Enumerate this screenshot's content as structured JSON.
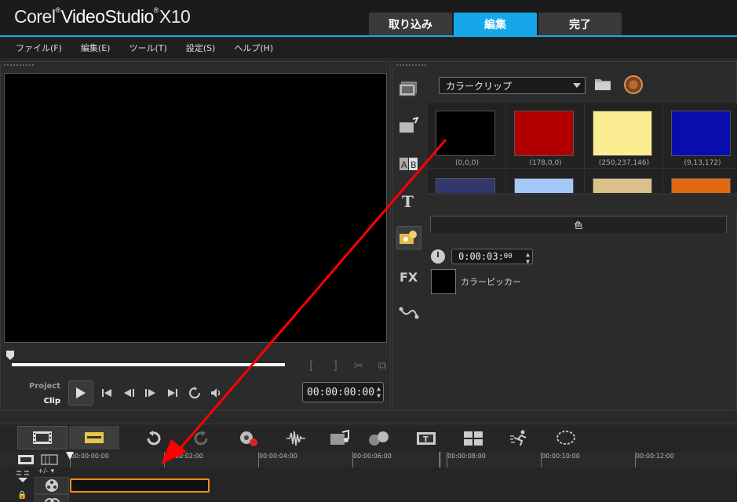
{
  "app": {
    "brand_prefix": "Corel",
    "brand_name": "VideoStudio",
    "brand_version": "X10"
  },
  "mode_tabs": [
    {
      "label": "取り込み",
      "active": false
    },
    {
      "label": "編集",
      "active": true
    },
    {
      "label": "完了",
      "active": false
    }
  ],
  "menu": [
    "ファイル(F)",
    "編集(E)",
    "ツール(T)",
    "設定(S)",
    "ヘルプ(H)"
  ],
  "player": {
    "project_label": "Project",
    "clip_label": "Clip",
    "timecode": "00:00:00:00",
    "timecode_hours": "00:00:00",
    "timecode_frames": "00"
  },
  "library": {
    "category": "カラークリップ",
    "swatches": [
      {
        "label": "(0,0,0)",
        "color": "#000000"
      },
      {
        "label": "(178,0,0)",
        "color": "#b20000"
      },
      {
        "label": "(250,237,146)",
        "color": "#faed92"
      },
      {
        "label": "(9,13,172)",
        "color": "#090dac"
      },
      {
        "label": "",
        "color": "#32386e"
      },
      {
        "label": "",
        "color": "#a4c8f8"
      },
      {
        "label": "",
        "color": "#dcc08a"
      },
      {
        "label": "",
        "color": "#e06a10"
      }
    ],
    "color_tab": "色",
    "duration_main": "0:00:03:",
    "duration_frames": "00",
    "color_picker_label": "カラーピッカー"
  },
  "timeline": {
    "ruler_labels": [
      "00:00:00:00",
      "00:00:02:00",
      "00:00:04:00",
      "00:00:06:00",
      "00:00:08:00",
      "00:00:10:00",
      "00:00:12:00"
    ],
    "track_toggle_label": "+/- ▾"
  },
  "colors": {
    "accent": "#16a6ea",
    "clip_border": "#f18f18",
    "annotation_arrow": "#ff0000"
  }
}
